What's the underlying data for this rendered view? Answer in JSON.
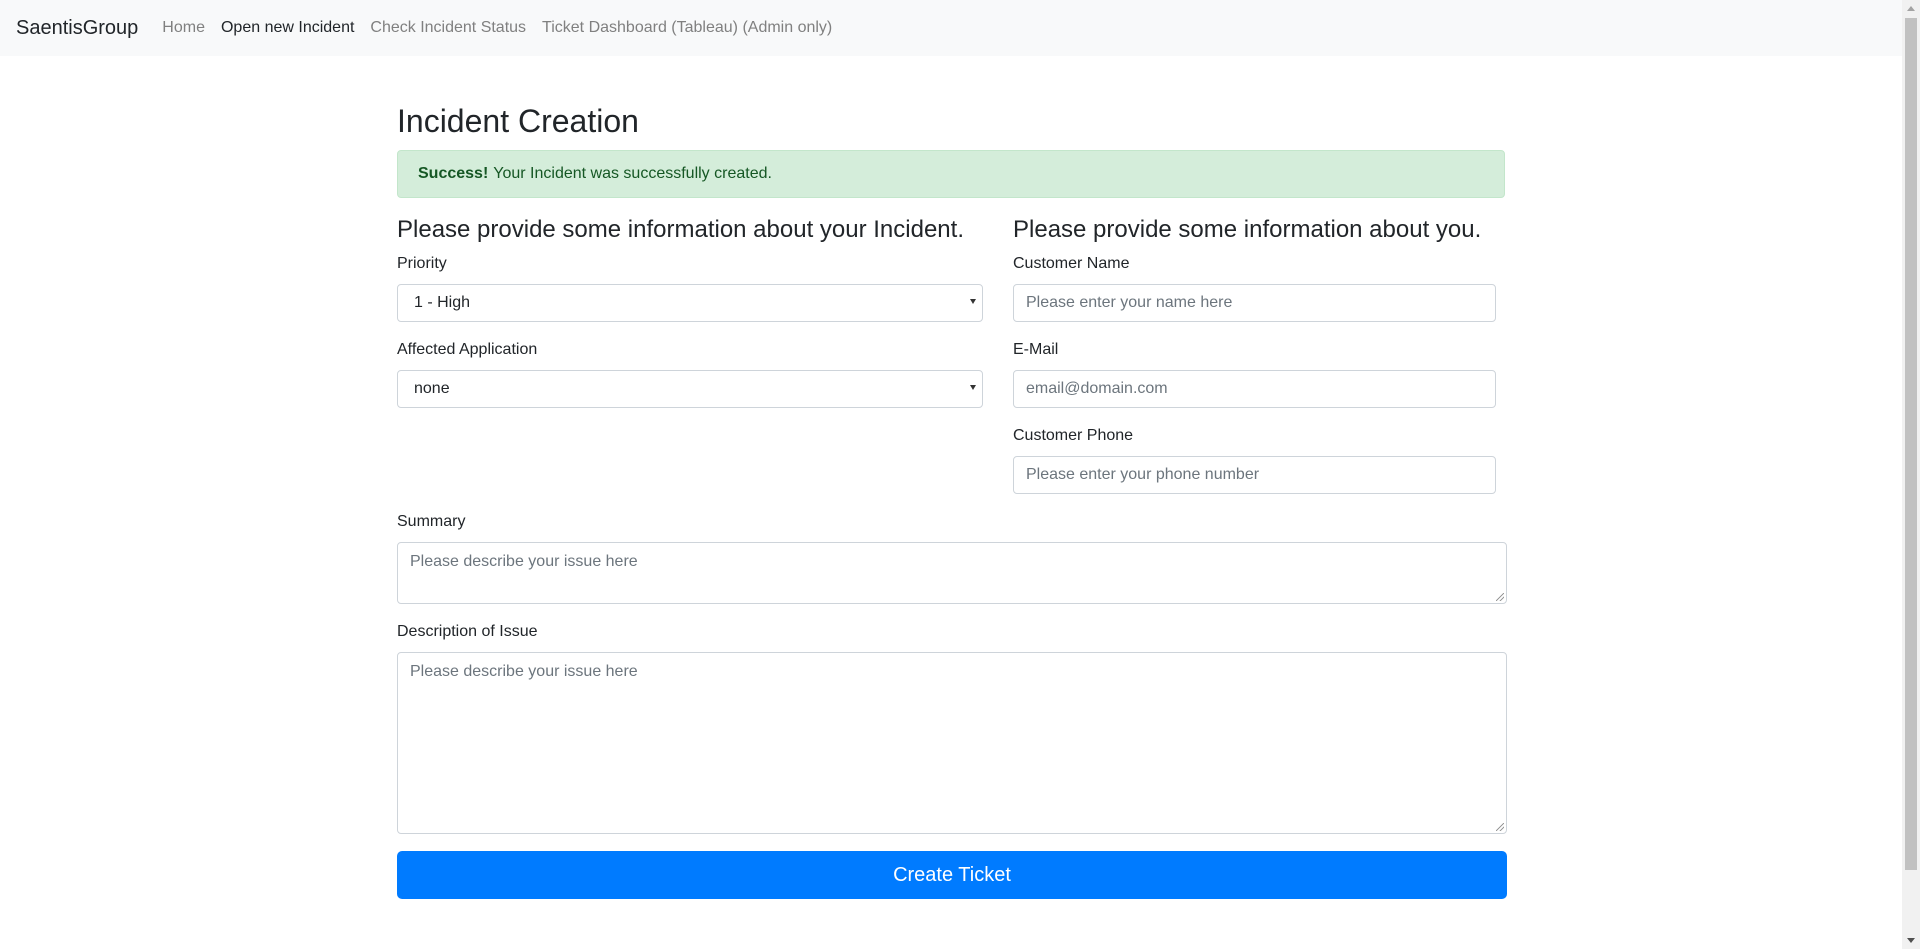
{
  "navbar": {
    "brand": "SaentisGroup",
    "links": [
      {
        "label": "Home"
      },
      {
        "label": "Open new Incident"
      },
      {
        "label": "Check Incident Status"
      },
      {
        "label": "Ticket Dashboard (Tableau) (Admin only)"
      }
    ]
  },
  "page": {
    "title": "Incident Creation",
    "alert": {
      "strong": "Success!",
      "text": "Your Incident was successfully created."
    }
  },
  "incident_section": {
    "heading": "Please provide some information about your Incident.",
    "priority": {
      "label": "Priority",
      "value": "1 - High"
    },
    "application": {
      "label": "Affected Application",
      "value": "none"
    }
  },
  "customer_section": {
    "heading": "Please provide some information about you.",
    "name": {
      "label": "Customer Name",
      "placeholder": "Please enter your name here"
    },
    "email": {
      "label": "E-Mail",
      "placeholder": "email@domain.com"
    },
    "phone": {
      "label": "Customer Phone",
      "placeholder": "Please enter your phone number"
    }
  },
  "summary": {
    "label": "Summary",
    "placeholder": "Please describe your issue here"
  },
  "description": {
    "label": "Description of Issue",
    "placeholder": "Please describe your issue here"
  },
  "submit_label": "Create Ticket",
  "colors": {
    "primary": "#007bff",
    "success_bg": "#d4edda",
    "success_text": "#155724",
    "navbar_bg": "#f8f9fa"
  }
}
